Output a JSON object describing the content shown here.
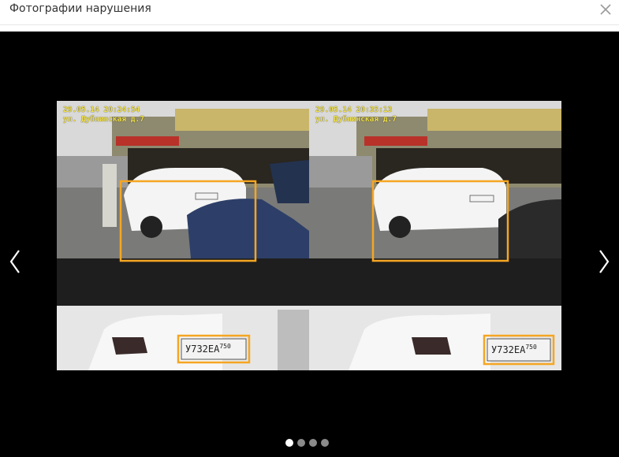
{
  "dialog": {
    "title": "Фотографии нарушения",
    "close_icon": "close-icon"
  },
  "viewer": {
    "prev_icon": "chevron-left-icon",
    "next_icon": "chevron-right-icon",
    "photos": [
      {
        "date": "29.05.14",
        "time": "20:24:54",
        "street": "ул. Дубнинская д.7",
        "plate": "У732ЕА",
        "region": "750"
      },
      {
        "date": "29.05.14",
        "time": "20:35:13",
        "street": "ул. Дубнинская д.7",
        "plate": "У732ЕА",
        "region": "750"
      }
    ],
    "pager": {
      "count": 4,
      "active": 1
    },
    "highlight_color": "#f5a623",
    "stamp_color": "#f2e24a"
  }
}
